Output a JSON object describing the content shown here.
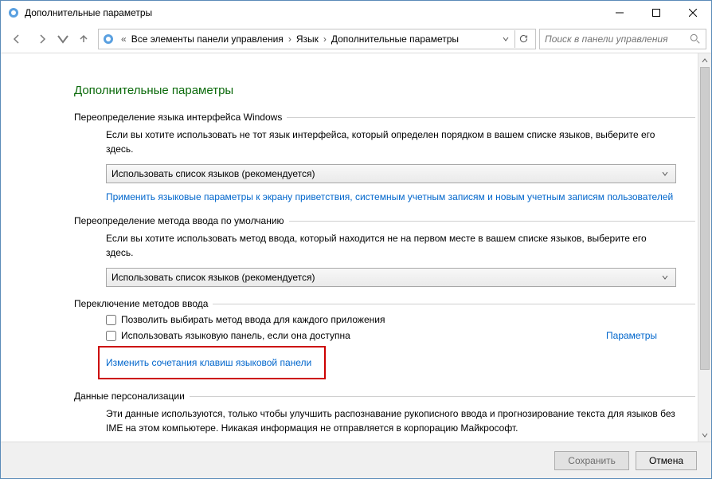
{
  "window": {
    "title": "Дополнительные параметры"
  },
  "breadcrumb": {
    "items": [
      "Все элементы панели управления",
      "Язык",
      "Дополнительные параметры"
    ]
  },
  "search": {
    "placeholder": "Поиск в панели управления"
  },
  "page": {
    "title": "Дополнительные параметры"
  },
  "section1": {
    "legend": "Переопределение языка интерфейса Windows",
    "desc": "Если вы хотите использовать не тот язык интерфейса, который определен порядком в вашем списке языков, выберите его здесь.",
    "combo": "Использовать список языков (рекомендуется)",
    "link": "Применить языковые параметры к экрану приветствия, системным учетным записям и новым учетным записям пользователей"
  },
  "section2": {
    "legend": "Переопределение метода ввода по умолчанию",
    "desc": "Если вы хотите использовать метод ввода, который находится не на первом месте в вашем списке языков, выберите его здесь.",
    "combo": "Использовать список языков (рекомендуется)"
  },
  "section3": {
    "legend": "Переключение методов ввода",
    "check1": "Позволить выбирать метод ввода для каждого приложения",
    "check2": "Использовать языковую панель, если она доступна",
    "params": "Параметры",
    "link": "Изменить сочетания клавиш языковой панели"
  },
  "section4": {
    "legend": "Данные персонализации",
    "desc": "Эти данные используются, только чтобы улучшить распознавание рукописного ввода и прогнозирование текста для языков без IME на этом компьютере. Никакая информация не отправляется в корпорацию Майкрософт."
  },
  "footer": {
    "save": "Сохранить",
    "cancel": "Отмена"
  }
}
